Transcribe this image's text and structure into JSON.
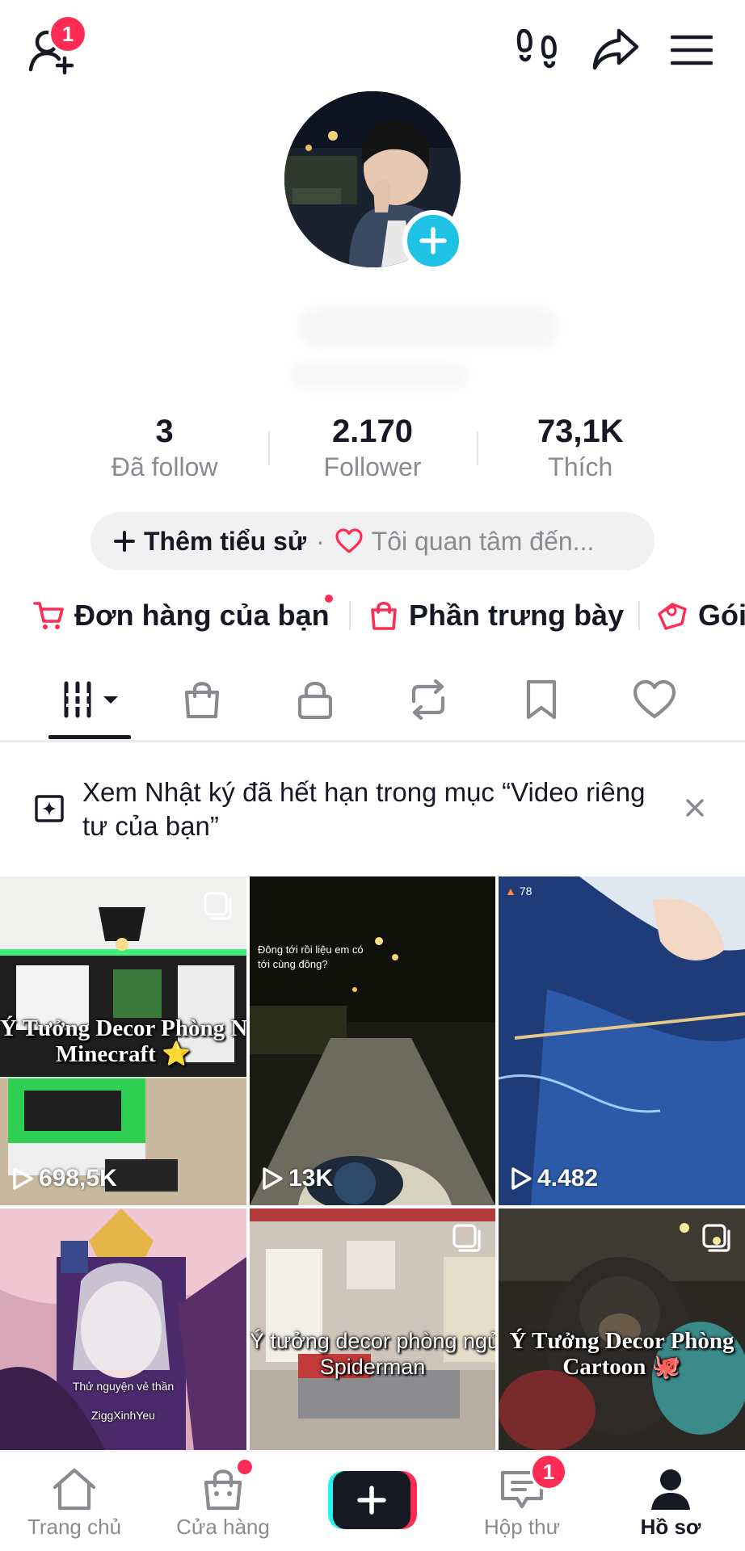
{
  "header": {
    "add_friends_badge": "1"
  },
  "profile": {
    "stats": [
      {
        "value": "3",
        "label": "Đã follow"
      },
      {
        "value": "2.170",
        "label": "Follower"
      },
      {
        "value": "73,1K",
        "label": "Thích"
      }
    ],
    "bio_add_label": "Thêm tiểu sử",
    "bio_separator": "·",
    "interest_label": "Tôi quan tâm đến..."
  },
  "shortcuts": [
    {
      "label": "Đơn hàng của bạn",
      "icon": "cart-icon",
      "has_dot": true
    },
    {
      "label": "Phần trưng bày",
      "icon": "shopping-bag-icon",
      "has_dot": false
    },
    {
      "label": "Gói",
      "icon": "gift-icon",
      "has_dot": false
    }
  ],
  "tabs": [
    {
      "name": "videos",
      "icon": "grid-icon",
      "active": true
    },
    {
      "name": "shop",
      "icon": "bag-icon",
      "active": false
    },
    {
      "name": "private",
      "icon": "lock-icon",
      "active": false
    },
    {
      "name": "reposts",
      "icon": "repost-icon",
      "active": false
    },
    {
      "name": "favorites",
      "icon": "bookmark-icon",
      "active": false
    },
    {
      "name": "liked",
      "icon": "heart-icon",
      "active": false
    }
  ],
  "notice": {
    "text": "Xem Nhật ký đã hết hạn trong mục “Video riêng tư của bạn”"
  },
  "videos": [
    {
      "overlay_line1": "Ý Tưởng Decor Phòng Ngủ",
      "overlay_line2": "Minecraft ⭐",
      "views": "698,5K",
      "multi": true
    },
    {
      "caption": "Đông tới rồi liệu em có tới cùng đông?",
      "views": "13K",
      "multi": false
    },
    {
      "corner_label": "78",
      "views": "4.482",
      "multi": false
    },
    {
      "overlay_line1": "Thử nguyện vẻ thần",
      "overlay_line2": "ZiggXinhYeu",
      "views": "",
      "multi": false
    },
    {
      "overlay_line1": "Ý tưởng decor phòng ngủ",
      "overlay_line2": "Spiderman",
      "views": "",
      "multi": true
    },
    {
      "overlay_line1": "Ý Tưởng Decor Phòng",
      "overlay_line2": "Cartoon 🐙",
      "views": "",
      "multi": true
    }
  ],
  "bottom_nav": {
    "home": "Trang chủ",
    "shop": "Cửa hàng",
    "inbox": "Hộp thư",
    "inbox_badge": "1",
    "profile": "Hồ sơ"
  },
  "colors": {
    "accent_pink": "#fe2c55",
    "accent_cyan": "#25f4ee",
    "avatar_plus": "#1fc1e5",
    "text_primary": "#161823",
    "text_secondary": "#8a8b91"
  }
}
